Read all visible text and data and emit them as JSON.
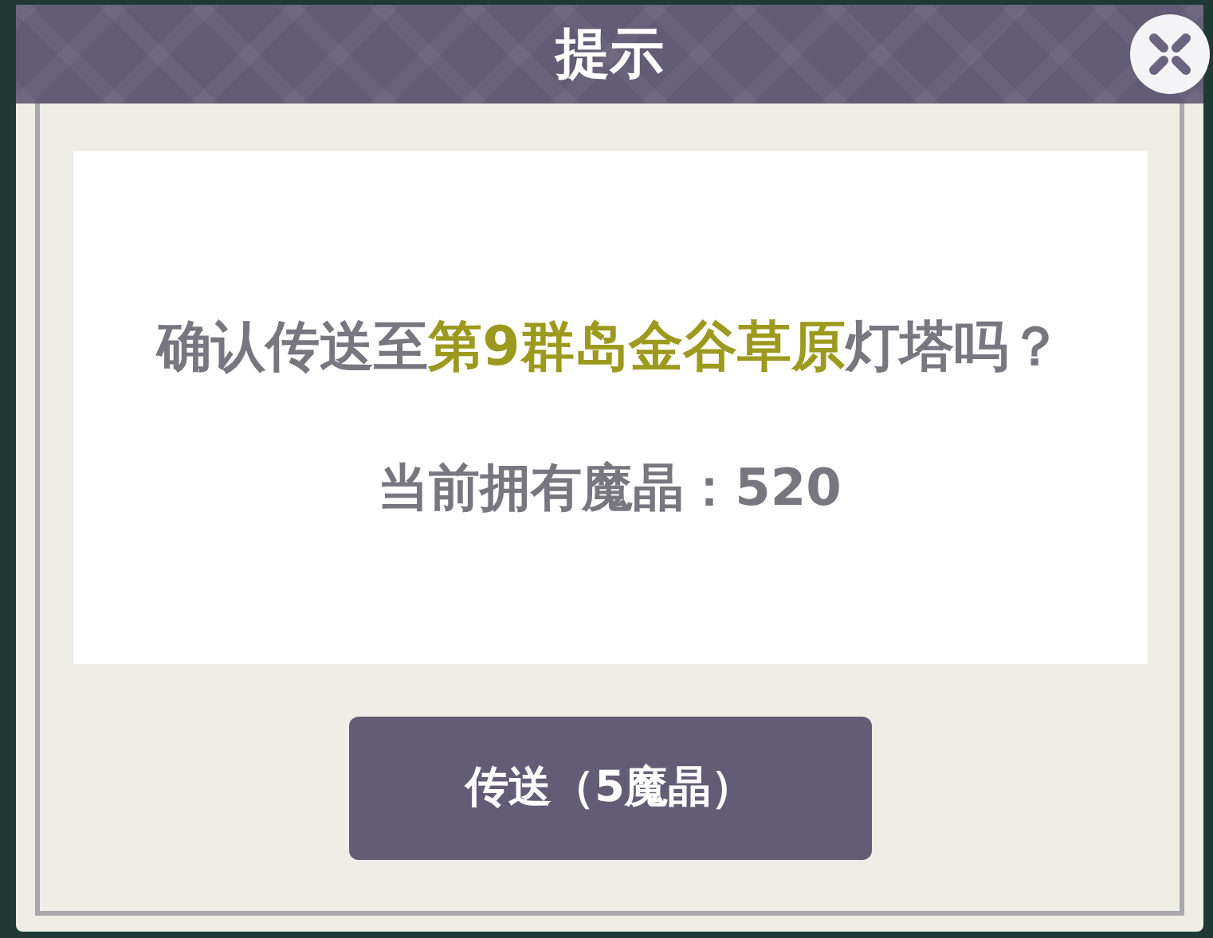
{
  "dialog": {
    "title": "提示",
    "message": {
      "before": "确认传送至",
      "place": "第9群岛金谷草原",
      "after": "灯塔吗？"
    },
    "balance": "当前拥有魔晶：520",
    "button": "传送（5魔晶）"
  }
}
